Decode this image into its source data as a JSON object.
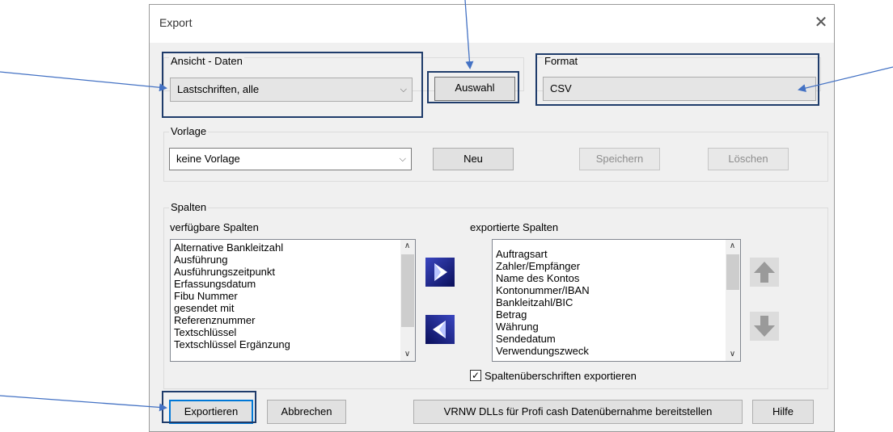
{
  "dialog": {
    "title": "Export",
    "close_glyph": "✕"
  },
  "ansicht": {
    "legend": "Ansicht - Daten",
    "selected": "Lastschriften, alle",
    "button": "Auswahl"
  },
  "format": {
    "legend": "Format",
    "value": "CSV"
  },
  "vorlage": {
    "legend": "Vorlage",
    "selected": "keine Vorlage",
    "new_button": "Neu",
    "save_button": "Speichern",
    "delete_button": "Löschen"
  },
  "spalten": {
    "legend": "Spalten",
    "available_label": "verfügbare Spalten",
    "exported_label": "exportierte Spalten",
    "available": [
      "Alternative Bankleitzahl",
      "Ausführung",
      "Ausführungszeitpunkt",
      "Erfassungsdatum",
      "Fibu Nummer",
      "gesendet mit",
      "Referenznummer",
      "Textschlüssel",
      "Textschlüssel Ergänzung"
    ],
    "exported": [
      "Auftragsart",
      "Zahler/Empfänger",
      "Name des Kontos",
      "Kontonummer/IBAN",
      "Bankleitzahl/BIC",
      "Betrag",
      "Währung",
      "Sendedatum",
      "Verwendungszweck"
    ],
    "header_checkbox_label": "Spaltenüberschriften exportieren",
    "header_checkbox_checked": true
  },
  "footer": {
    "export_button": "Exportieren",
    "cancel_button": "Abbrechen",
    "dll_button": "VRNW DLLs für Profi cash Datenübernahme bereitstellen",
    "help_button": "Hilfe"
  },
  "colors": {
    "annotation_arrow": "#4472c4",
    "highlight_box": "#1f3c6b"
  }
}
